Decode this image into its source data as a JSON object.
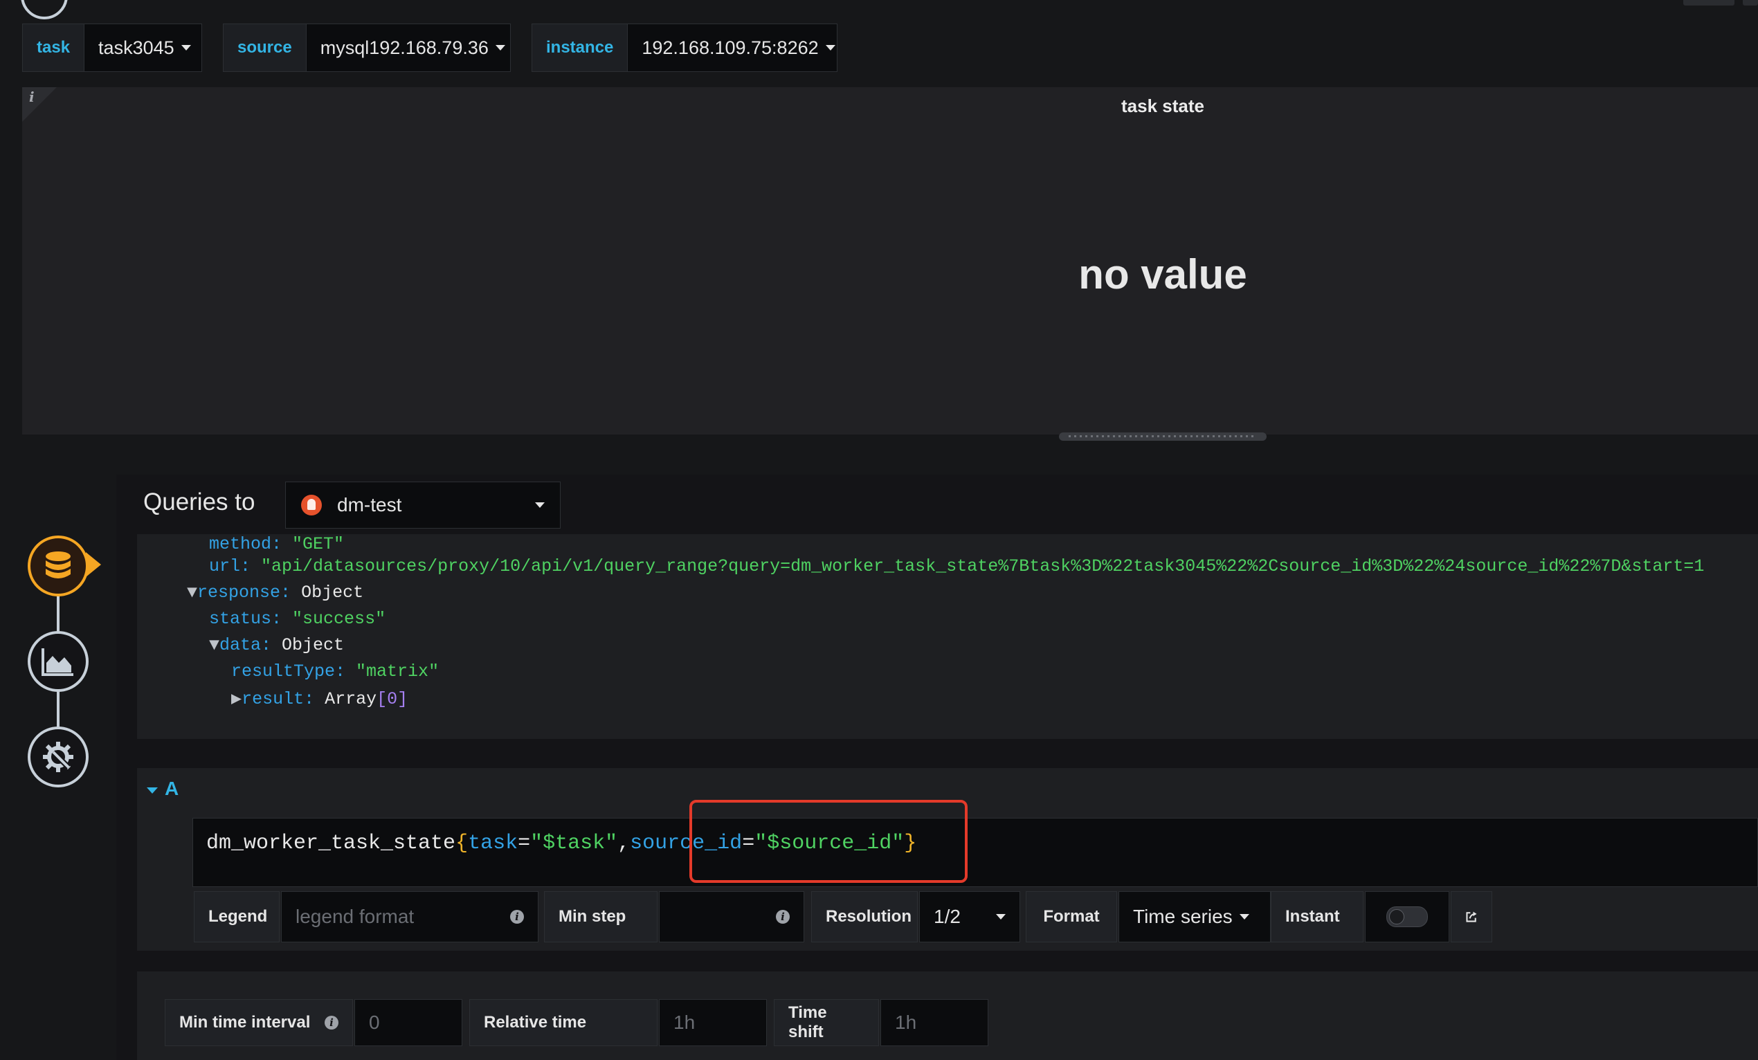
{
  "variables": [
    {
      "label": "task",
      "value": "task3045"
    },
    {
      "label": "source",
      "value": "mysql192.168.79.36"
    },
    {
      "label": "instance",
      "value": "192.168.109.75:8262"
    }
  ],
  "panel": {
    "info_glyph": "i",
    "title": "task state",
    "value_text": "no value"
  },
  "editor": {
    "queries_to": "Queries to",
    "datasource": "dm-test",
    "steps": [
      "database-icon",
      "chart-area-icon",
      "gear-wrench-icon"
    ]
  },
  "inspector": {
    "method_key": "method:",
    "method_val": "\"GET\"",
    "url_key": "url:",
    "url_val": "\"api/datasources/proxy/10/api/v1/query_range?query=dm_worker_task_state%7Btask%3D%22task3045%22%2Csource_id%3D%22%24source_id%22%7D&start=1",
    "response_key": "response:",
    "response_val": "Object",
    "status_key": "status:",
    "status_val": "\"success\"",
    "data_key": "data:",
    "data_val": "Object",
    "resultType_key": "resultType:",
    "resultType_val": "\"matrix\"",
    "result_key": "result:",
    "result_val": "Array",
    "result_count": "[0]"
  },
  "query": {
    "ref": "A",
    "metric": "dm_worker_task_state",
    "open_brace": "{",
    "label1": "task",
    "eq1": "=",
    "val1": "\"$task\"",
    "comma": ",",
    "label2": "source_id",
    "eq2": "=",
    "val2": "\"$source_id\"",
    "close_brace": "}"
  },
  "options": {
    "legend_label": "Legend",
    "legend_placeholder": "legend format",
    "minstep_label": "Min step",
    "resolution_label": "Resolution",
    "resolution_value": "1/2",
    "format_label": "Format",
    "format_value": "Time series",
    "instant_label": "Instant"
  },
  "bottom": {
    "min_interval_label": "Min time interval",
    "min_interval_placeholder": "0",
    "relative_label": "Relative time",
    "relative_placeholder": "1h",
    "timeshift_label": "Time shift",
    "timeshift_placeholder": "1h"
  }
}
